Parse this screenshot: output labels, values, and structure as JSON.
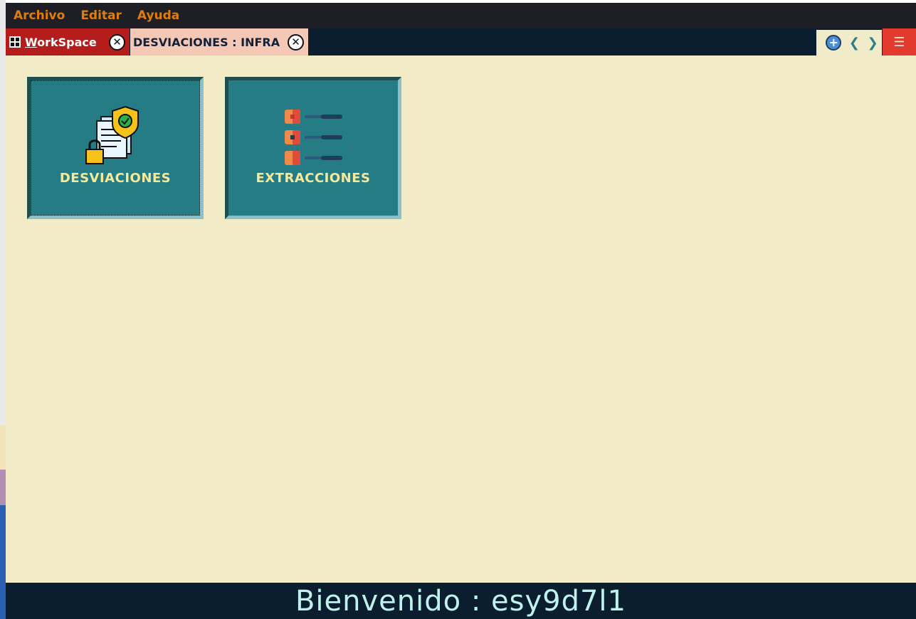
{
  "menubar": {
    "items": [
      "Archivo",
      "Editar",
      "Ayuda"
    ]
  },
  "tabs": [
    {
      "label": "WorkSpace",
      "icon": "grid-icon",
      "active": true
    },
    {
      "label": "DESVIACIONES : INFRA",
      "active": false
    }
  ],
  "tab_tools": {
    "add_icon": "add-tab-icon",
    "prev": "❮",
    "next": "❯",
    "menu": "☰"
  },
  "tiles": [
    {
      "label": "DESVIACIONES",
      "icon": "document-shield-lock-icon"
    },
    {
      "label": "EXTRACCIONES",
      "icon": "checklist-icon"
    }
  ],
  "footer": {
    "welcome": "Bienvenido : esy9d7l1"
  },
  "colors": {
    "menubar_bg": "#1e1f25",
    "menu_text": "#e07d0a",
    "tabbar_bg": "#0b1e30",
    "active_tab": "#b51d1d",
    "inactive_tab": "#f4c8b4",
    "workspace_bg": "#f2ebc7",
    "tile_bg": "#267c84",
    "tile_text": "#f6e99a",
    "hamburger_bg": "#e23a2e"
  }
}
